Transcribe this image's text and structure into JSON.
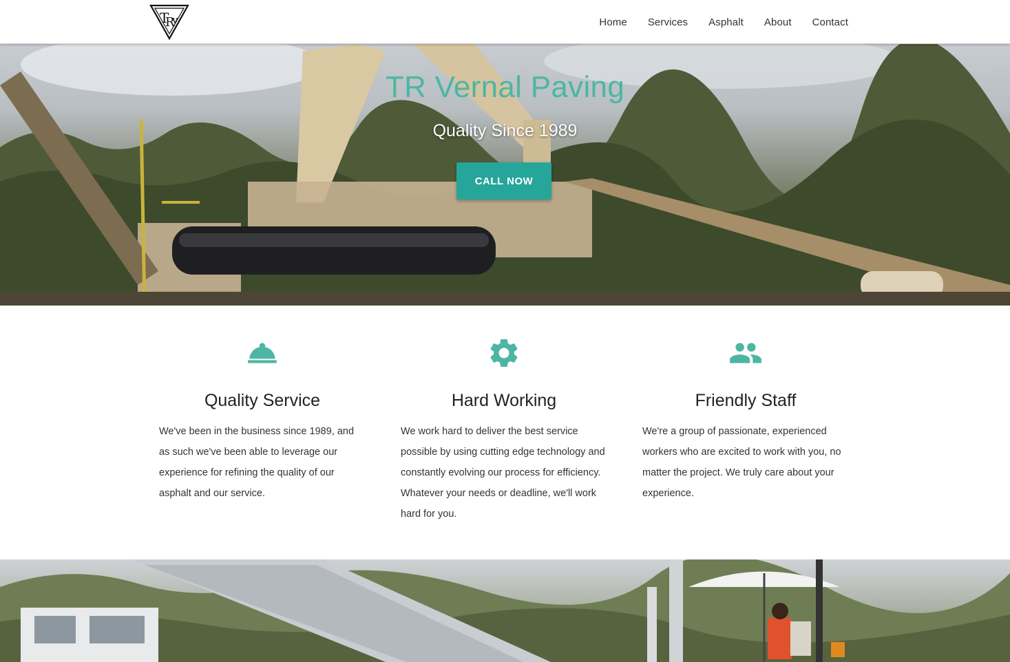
{
  "brand": {
    "logo_text": "TR V",
    "logo_name": "tr-vernal-triangle-logo"
  },
  "nav": {
    "items": [
      {
        "label": "Home"
      },
      {
        "label": "Services"
      },
      {
        "label": "Asphalt"
      },
      {
        "label": "About"
      },
      {
        "label": "Contact"
      }
    ]
  },
  "hero": {
    "title": "TR Vernal Paving",
    "subtitle": "Quality Since 1989",
    "cta_label": "CALL NOW",
    "background_image": "asphalt-plant-photo"
  },
  "colors": {
    "accent": "#26a69a",
    "title_accent": "#4db6a3",
    "icon": "#4db6a3"
  },
  "features": [
    {
      "icon": "room-service-icon",
      "title": "Quality Service",
      "text": "We've been in the business since 1989, and as such we've been able to leverage our experience for refining the quality of our asphalt and our service."
    },
    {
      "icon": "gear-icon",
      "title": "Hard Working",
      "text": "We work hard to deliver the best service possible by using cutting edge technology and constantly evolving our process for efficiency. Whatever your needs or deadline, we'll work hard for you."
    },
    {
      "icon": "group-icon",
      "title": "Friendly Staff",
      "text": "We're a group of passionate, experienced workers who are excited to work with you, no matter the project. We truly care about your experience."
    }
  ],
  "bottom_band": {
    "background_image": "dump-truck-paver-photo"
  }
}
